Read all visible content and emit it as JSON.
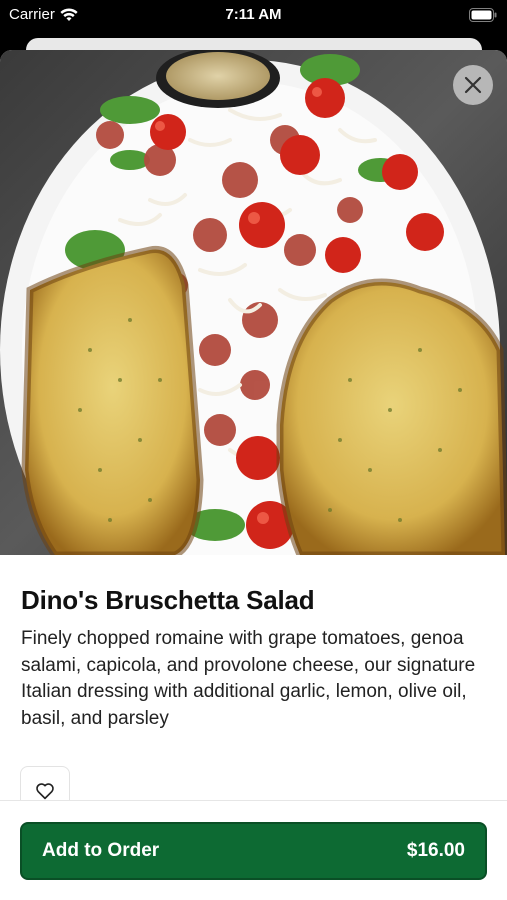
{
  "status_bar": {
    "carrier": "Carrier",
    "time": "7:11 AM"
  },
  "item": {
    "title": "Dino's Bruschetta Salad",
    "description": "Finely chopped romaine with grape tomatoes, genoa salami, capicola, and provolone cheese, our signature Italian dressing with additional  garlic, lemon, olive oil, basil, and parsley",
    "image_icon": "food-photo"
  },
  "actions": {
    "close_icon": "close-icon",
    "favorite_icon": "heart-outline-icon",
    "add_to_order_label": "Add to Order",
    "price": "$16.00"
  },
  "colors": {
    "primary": "#0d6a33",
    "close_bg": "#c8c8c8"
  }
}
